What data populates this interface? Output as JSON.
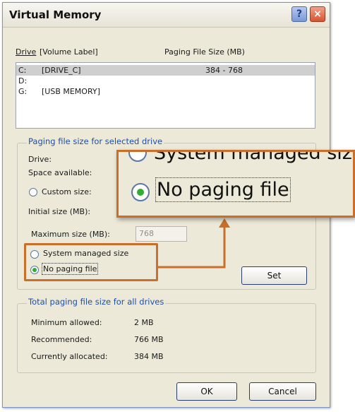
{
  "window": {
    "title": "Virtual Memory",
    "help_label": "?",
    "close_label": "×"
  },
  "drives_list": {
    "col_drive": "Drive",
    "col_volume": "[Volume Label]",
    "col_size": "Paging File Size (MB)",
    "rows": [
      {
        "drive": "C:",
        "label": "[DRIVE_C]",
        "size": "384 - 768"
      },
      {
        "drive": "D:",
        "label": "",
        "size": ""
      },
      {
        "drive": "G:",
        "label": "[USB MEMORY]",
        "size": ""
      }
    ]
  },
  "paging": {
    "legend": "Paging file size for selected drive",
    "drive_label": "Drive:",
    "space_label": "Space available:",
    "custom_size": "Custom size:",
    "initial_label": "Initial size (MB):",
    "maximum_label": "Maximum size (MB):",
    "maximum_value": "768",
    "system_managed": "System managed size",
    "no_paging": "No paging file",
    "set_button": "Set"
  },
  "totals": {
    "legend": "Total paging file size for all drives",
    "min_label": "Minimum allowed:",
    "min_value": "2 MB",
    "rec_label": "Recommended:",
    "rec_value": "766 MB",
    "cur_label": "Currently allocated:",
    "cur_value": "384 MB"
  },
  "buttons": {
    "ok": "OK",
    "cancel": "Cancel"
  },
  "zoom": {
    "system_managed": "System managed size",
    "no_paging": "No paging file"
  },
  "colors": {
    "accent_callout": "#c96f2a",
    "legend_blue": "#1f4fa6",
    "radio_selected": "#2fae2f"
  }
}
